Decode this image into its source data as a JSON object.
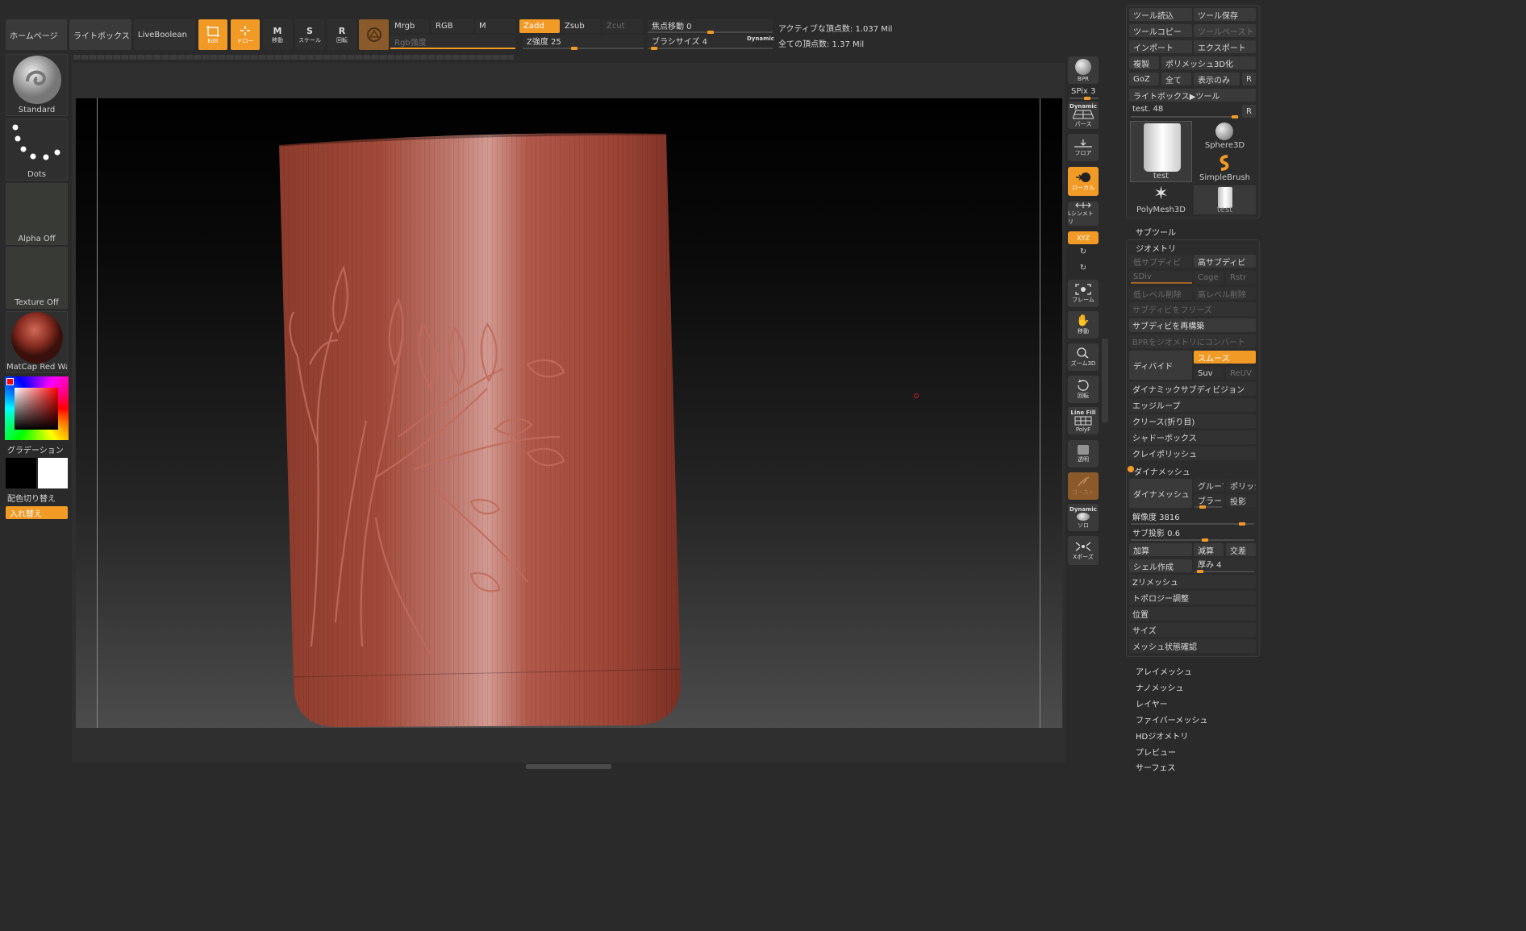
{
  "top_bar": {
    "home": "ホームページ",
    "lightbox": "ライトボックス",
    "liveboolean": "LiveBoolean",
    "edit": "Edit",
    "draw": "ドロー",
    "move": "移動",
    "scale": "スケール",
    "rotate": "回転",
    "mrgb": "Mrgb",
    "rgb": "RGB",
    "m": "M",
    "rgb_intensity": "Rgb強度",
    "zadd": "Zadd",
    "zsub": "Zsub",
    "zcut": "Zcut",
    "z_intensity": "Z強度 25",
    "focal_shift": "焦点移動 0",
    "brush_size": "ブラシサイズ 4",
    "dynamic": "Dynamic",
    "active_points": "アクティブな頂点数: 1.037 Mil",
    "total_points": "全ての頂点数: 1.37 Mil"
  },
  "sliders": {
    "z_intensity": 0.25,
    "focal_shift": 0.5,
    "brush_size": 0.05,
    "rgb_intensity": 1.0,
    "spix": 0.6,
    "sdiv": 1.0,
    "resolution": 0.9,
    "sub_projection": 0.6,
    "thickness": 0.1,
    "brush_blur": 0.3,
    "test_count": 0.96
  },
  "left_panel": {
    "brush": "Standard",
    "stroke": "Dots",
    "alpha": "Alpha Off",
    "texture": "Texture Off",
    "material": "MatCap Red Wax",
    "gradient": "グラデーション",
    "switch_color": "配色切り替え",
    "swap": "入れ替え"
  },
  "right_toolbar": {
    "bpr": "BPR",
    "spix": "SPix 3",
    "dynamic_top": "Dynamic",
    "perspective": "パース",
    "floor": "フロア",
    "local": "ローカル",
    "symmetry": "Lシンメトリ",
    "xyz": "XYZ",
    "frame": "フレーム",
    "move": "移動",
    "zoom3d": "ズーム3D",
    "rotate": "回転",
    "linefill": "Line Fill",
    "polyf": "PolyF",
    "transp": "透明",
    "ghost": "ゴースト",
    "dynamic_bottom": "Dynamic",
    "solo": "ソロ",
    "xpose": "Xポーズ"
  },
  "tool_panel": {
    "load_tool": "ツール読込",
    "save_tool": "ツール保存",
    "copy_tool": "ツールコピー",
    "paste_tool": "ツールペースト",
    "import": "インポート",
    "export": "エクスポート",
    "clone": "複製",
    "make_polymesh": "ポリメッシュ3D化",
    "goz": "GoZ",
    "all": "全て",
    "visible": "表示のみ",
    "r": "R",
    "lightbox_tool": "ライトボックス▶ツール",
    "test_name": "test. 48",
    "thumb_test": "test",
    "thumb_sphere": "Sphere3D",
    "thumb_simplebrush": "SimpleBrush",
    "thumb_polymesh": "PolyMesh3D",
    "thumb_test2": "test"
  },
  "subtool": {
    "title": "サブツール",
    "geometry": "ジオメトリ",
    "lower_res": "低サブディビ",
    "higher_res": "高サブディビ",
    "sdiv": "SDiv",
    "cage": "Cage",
    "rstr": "Rstr",
    "del_lower": "低レベル削除",
    "del_higher": "高レベル削除",
    "freeze": "サブディビをフリーズ",
    "reconstruct": "サブディビを再構築",
    "convert_bpr": "BPRをジオメトリにコンバート",
    "divide": "ディバイド",
    "smooth": "スムース",
    "suv": "Suv",
    "reuv": "ReUV",
    "dynamic_subdiv": "ダイナミックサブディビジョン",
    "edgeloop": "エッジループ",
    "crease": "クリース(折り目)",
    "shadowbox": "シャドーボックス",
    "claypolish": "クレイポリッシュ",
    "dynamesh_head": "ダイナメッシュ",
    "dynamesh_btn": "ダイナメッシュ",
    "groups": "グループ",
    "polish": "ポリッシュ",
    "blur": "ブラー",
    "project": "投影",
    "resolution": "解像度 3816",
    "sub_projection": "サブ投影 0.6",
    "add": "加算",
    "sub": "減算",
    "and": "交差",
    "create_shell": "シェル作成",
    "thickness": "厚み 4",
    "zremesher": "Zリメッシュ",
    "topology": "トポロジー調整",
    "position": "位置",
    "size": "サイズ",
    "mesh_integrity": "メッシュ状態確認"
  },
  "lower_sections": [
    "アレイメッシュ",
    "ナノメッシュ",
    "レイヤー",
    "ファイバーメッシュ",
    "HDジオメトリ",
    "プレビュー",
    "サーフェス"
  ],
  "colors": {
    "accent": "#f29a26",
    "panel": "#2a2a2a",
    "button": "#3a3a3a",
    "model": "#a2493a"
  }
}
